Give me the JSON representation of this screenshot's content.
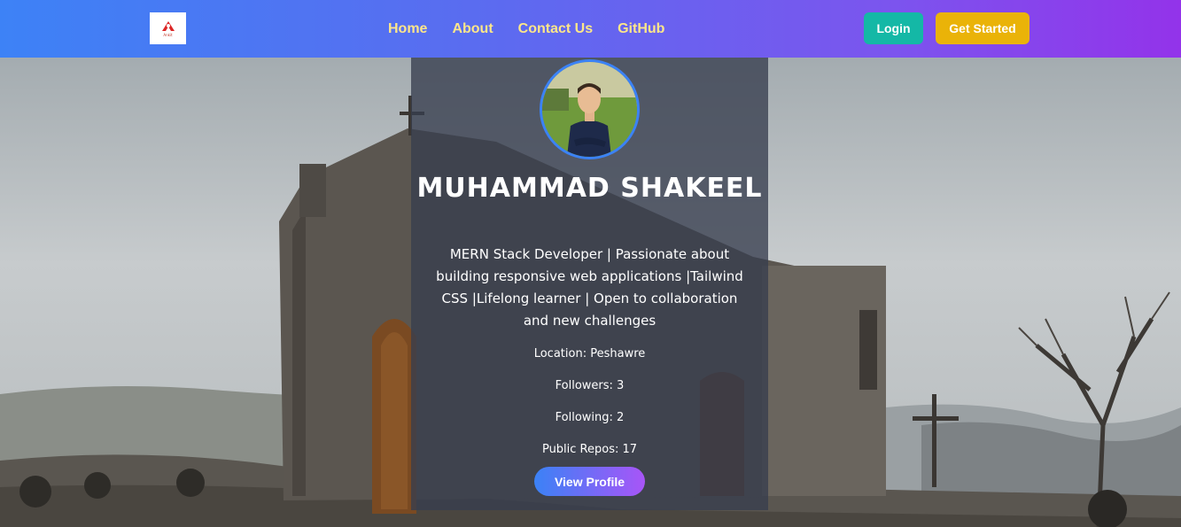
{
  "nav": {
    "logo_text": "Ankit",
    "links": [
      {
        "label": "Home"
      },
      {
        "label": "About"
      },
      {
        "label": "Contact Us"
      },
      {
        "label": "GitHub"
      }
    ],
    "login_label": "Login",
    "get_started_label": "Get Started"
  },
  "profile": {
    "name": "MUHAMMAD SHAKEEL",
    "bio": "MERN Stack Developer | Passionate about building responsive web applications |Tailwind CSS |Lifelong learner | Open to collaboration and new challenges",
    "location": "Location: Peshawre",
    "followers": "Followers: 3",
    "following": "Following: 2",
    "public_repos": "Public Repos: 17",
    "view_profile_label": "View Profile"
  },
  "colors": {
    "nav_gradient_start": "#3d82f6",
    "nav_gradient_end": "#9333ea",
    "nav_link": "#fde68a",
    "login_bg": "#14b8a6",
    "get_started_bg": "#eab308",
    "avatar_border": "#3b82f6"
  },
  "icons": {
    "logo": "brand-logo"
  }
}
